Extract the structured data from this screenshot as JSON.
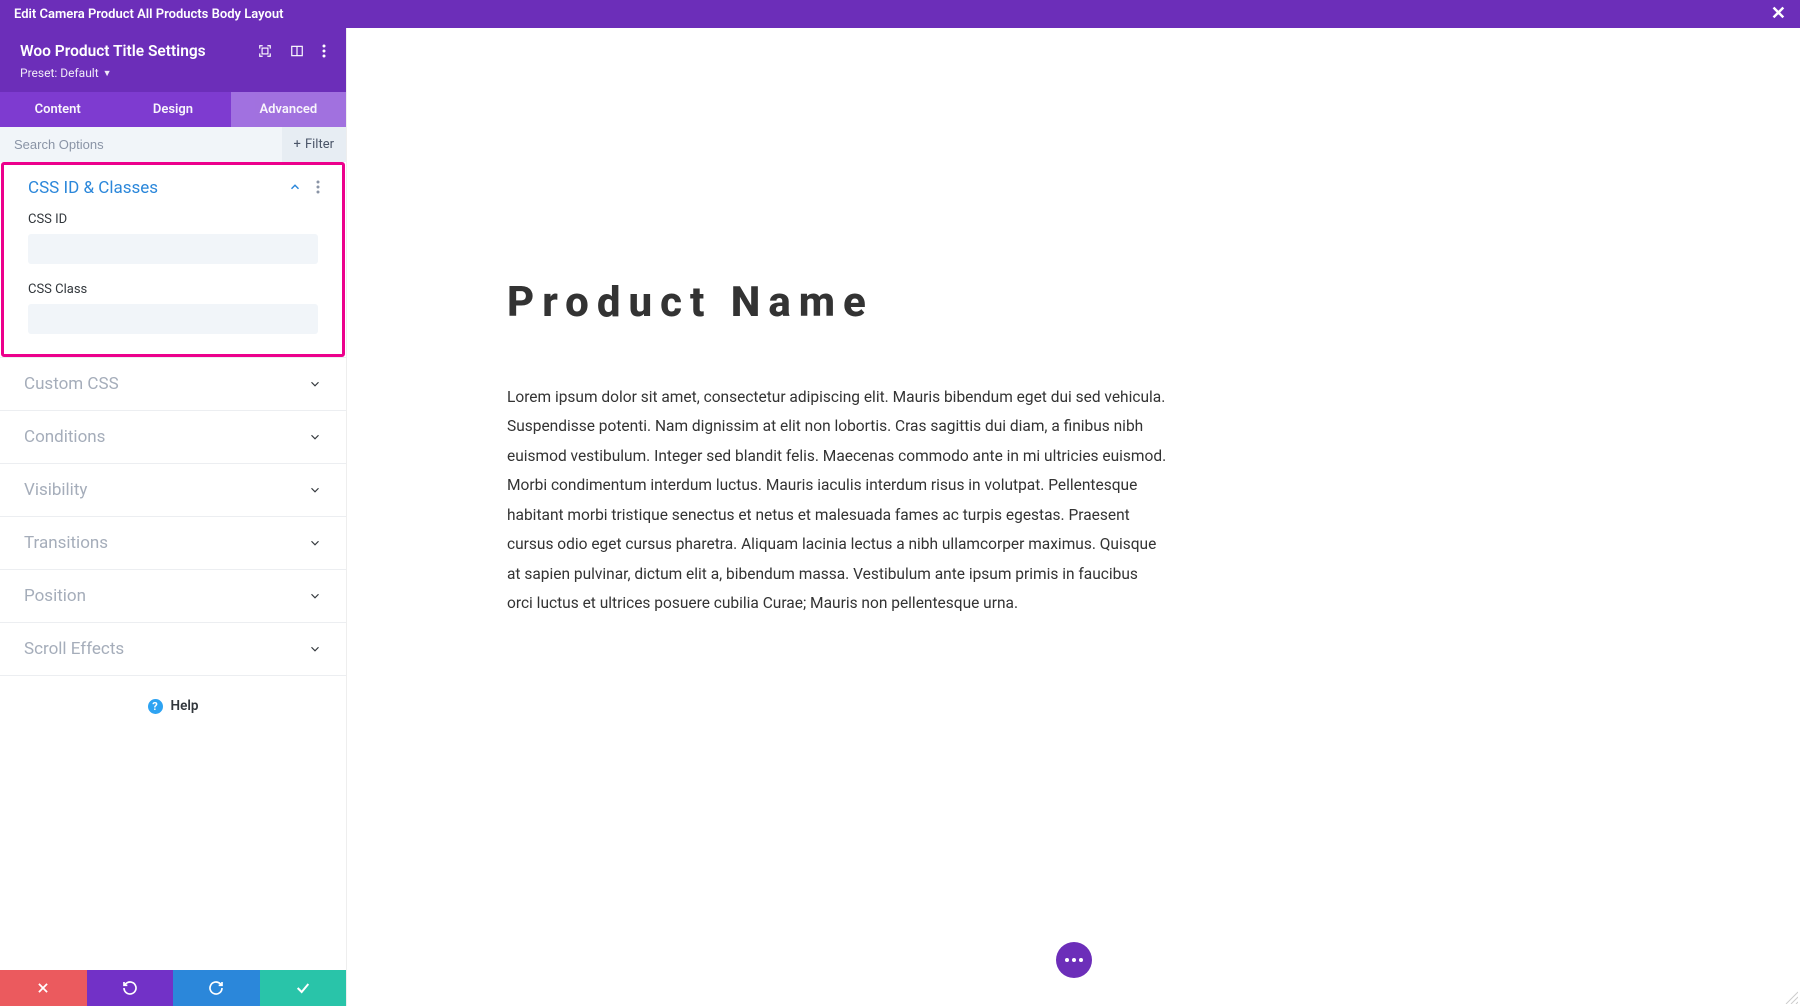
{
  "topbar": {
    "title": "Edit Camera Product All Products Body Layout"
  },
  "sidebar": {
    "title": "Woo Product Title Settings",
    "preset_label": "Preset: Default",
    "tabs": {
      "content": "Content",
      "design": "Design",
      "advanced": "Advanced"
    },
    "search_placeholder": "Search Options",
    "filter_label": "Filter",
    "expanded": {
      "title": "CSS ID & Classes",
      "css_id_label": "CSS ID",
      "css_id_value": "",
      "css_class_label": "CSS Class",
      "css_class_value": ""
    },
    "collapsed": [
      "Custom CSS",
      "Conditions",
      "Visibility",
      "Transitions",
      "Position",
      "Scroll Effects"
    ],
    "help_label": "Help"
  },
  "preview": {
    "title": "Product Name",
    "description": "Lorem ipsum dolor sit amet, consectetur adipiscing elit. Mauris bibendum eget dui sed vehicula. Suspendisse potenti. Nam dignissim at elit non lobortis. Cras sagittis dui diam, a finibus nibh euismod vestibulum. Integer sed blandit felis. Maecenas commodo ante in mi ultricies euismod. Morbi condimentum interdum luctus. Mauris iaculis interdum risus in volutpat. Pellentesque habitant morbi tristique senectus et netus et malesuada fames ac turpis egestas. Praesent cursus odio eget cursus pharetra. Aliquam lacinia lectus a nibh ullamcorper maximus. Quisque at sapien pulvinar, dictum elit a, bibendum massa. Vestibulum ante ipsum primis in faucibus orci luctus et ultrices posuere cubilia Curae; Mauris non pellentesque urna."
  }
}
